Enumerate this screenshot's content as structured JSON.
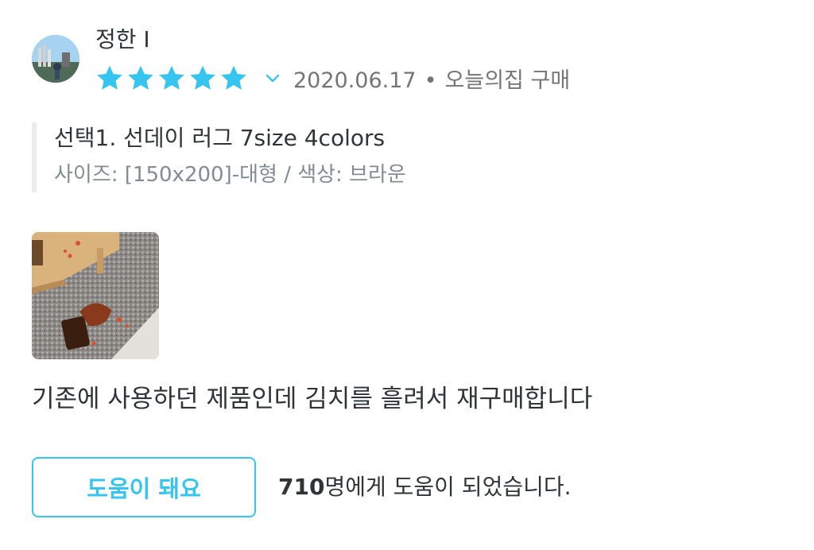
{
  "review": {
    "author": "정한 I",
    "rating": 5,
    "rating_max": 5,
    "date": "2020.06.17",
    "separator": "•",
    "purchase_source": "오늘의집 구매",
    "option_title": "선택1. 선데이 러그 7size 4colors",
    "option_detail": "사이즈: [150x200]-대형 / 색상: 브라운",
    "text": "기존에 사용하던 제품인데 김치를 흘려서 재구매합니다"
  },
  "helpful": {
    "button_label": "도움이 돼요",
    "count": "710",
    "count_suffix": "명에게 도움이 되었습니다."
  },
  "colors": {
    "accent": "#35c5f0",
    "text_primary": "#2f3438",
    "text_secondary": "#828c94",
    "option_bar": "#eaedef"
  },
  "icons": {
    "star": "star-icon",
    "expand": "chevron-down-icon"
  }
}
